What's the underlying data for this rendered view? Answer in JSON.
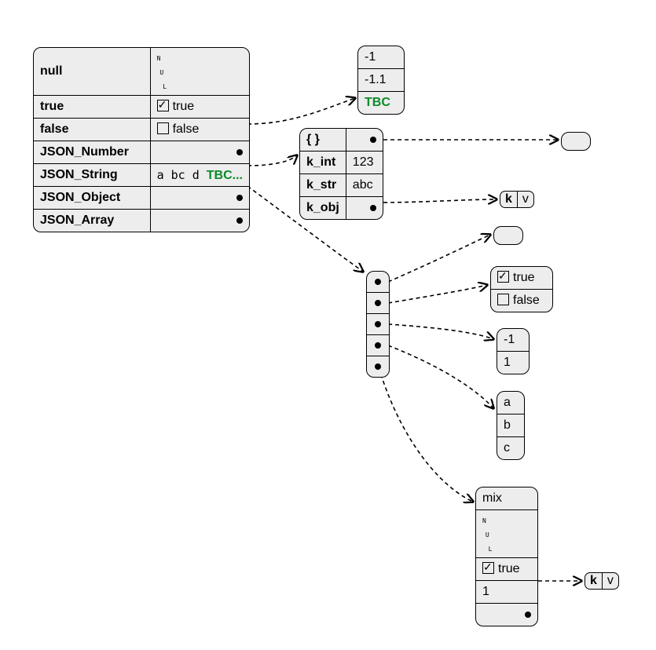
{
  "main_table": {
    "rows": [
      {
        "key": "null",
        "val_special": "nul"
      },
      {
        "key": "true",
        "val": "true",
        "check": "on"
      },
      {
        "key": "false",
        "val": "false",
        "check": "off"
      },
      {
        "key": "JSON_Number",
        "port": true
      },
      {
        "key": "JSON_String",
        "val_raw": "a bc  d ",
        "val_tbc": "TBC..."
      },
      {
        "key": "JSON_Object",
        "port": true
      },
      {
        "key": "JSON_Array",
        "port": true
      }
    ]
  },
  "num_box": {
    "items": [
      "-1",
      "-1.1"
    ],
    "tbc": "TBC"
  },
  "obj_box": {
    "head": "{ }",
    "rows": [
      {
        "k": "k_int",
        "v": "123"
      },
      {
        "k": "k_str",
        "v": "abc"
      },
      {
        "k": "k_obj",
        "port": true
      }
    ]
  },
  "kv1": {
    "k": "k",
    "v": "v"
  },
  "kv2": {
    "k": "k",
    "v": "v"
  },
  "bool_box": {
    "t": "true",
    "f": "false"
  },
  "nums2": {
    "a": "-1",
    "b": "1"
  },
  "strs": {
    "a": "a",
    "b": "b",
    "c": "c"
  },
  "mix": {
    "title": "mix",
    "t": "true",
    "n": "1"
  }
}
